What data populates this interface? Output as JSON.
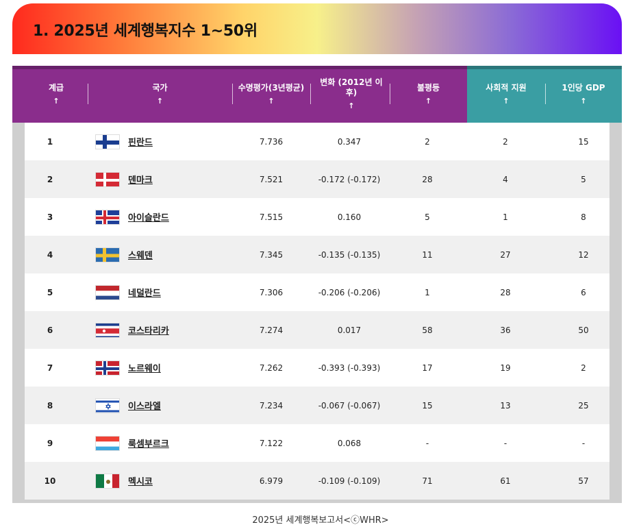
{
  "title": "1. 2025년 세계행복지수 1~50위",
  "table": {
    "headers": [
      {
        "label": "계급",
        "arrow": "↑"
      },
      {
        "label": "국가",
        "arrow": "↑"
      },
      {
        "label": "수명평가(3년평균)",
        "arrow": "↑"
      },
      {
        "label": "변화 (2012년 이후)",
        "arrow": "↑"
      },
      {
        "label": "불평등",
        "arrow": "↑"
      },
      {
        "label": "사회적 지원",
        "arrow": "↑"
      },
      {
        "label": "1인당 GDP",
        "arrow": "↑"
      }
    ],
    "rows": [
      {
        "rank": "1",
        "country": "핀란드",
        "flag": "finland-flag",
        "life": "7.736",
        "change": "0.347",
        "inequality": "2",
        "social": "2",
        "gdp": "15"
      },
      {
        "rank": "2",
        "country": "덴마크",
        "flag": "denmark-flag",
        "life": "7.521",
        "change": "-0.172 (-0.172)",
        "inequality": "28",
        "social": "4",
        "gdp": "5"
      },
      {
        "rank": "3",
        "country": "아이슬란드",
        "flag": "iceland-flag",
        "life": "7.515",
        "change": "0.160",
        "inequality": "5",
        "social": "1",
        "gdp": "8"
      },
      {
        "rank": "4",
        "country": "스웨덴",
        "flag": "sweden-flag",
        "life": "7.345",
        "change": "-0.135 (-0.135)",
        "inequality": "11",
        "social": "27",
        "gdp": "12"
      },
      {
        "rank": "5",
        "country": "네덜란드",
        "flag": "netherlands-flag",
        "life": "7.306",
        "change": "-0.206 (-0.206)",
        "inequality": "1",
        "social": "28",
        "gdp": "6"
      },
      {
        "rank": "6",
        "country": "코스타리카",
        "flag": "costa-rica-flag",
        "life": "7.274",
        "change": "0.017",
        "inequality": "58",
        "social": "36",
        "gdp": "50"
      },
      {
        "rank": "7",
        "country": "노르웨이",
        "flag": "norway-flag",
        "life": "7.262",
        "change": "-0.393 (-0.393)",
        "inequality": "17",
        "social": "19",
        "gdp": "2"
      },
      {
        "rank": "8",
        "country": "이스라엘",
        "flag": "israel-flag",
        "life": "7.234",
        "change": "-0.067 (-0.067)",
        "inequality": "15",
        "social": "13",
        "gdp": "25"
      },
      {
        "rank": "9",
        "country": "룩셈부르크",
        "flag": "luxembourg-flag",
        "life": "7.122",
        "change": "0.068",
        "inequality": "-",
        "social": "-",
        "gdp": "-"
      },
      {
        "rank": "10",
        "country": "멕시코",
        "flag": "mexico-flag",
        "life": "6.979",
        "change": "-0.109 (-0.109)",
        "inequality": "71",
        "social": "61",
        "gdp": "57"
      }
    ]
  },
  "caption": "2025년 세계행복보고서<ⓒWHR>",
  "colors": {
    "header_purple": "#8a2d8c",
    "header_teal": "#3a9ea3"
  }
}
